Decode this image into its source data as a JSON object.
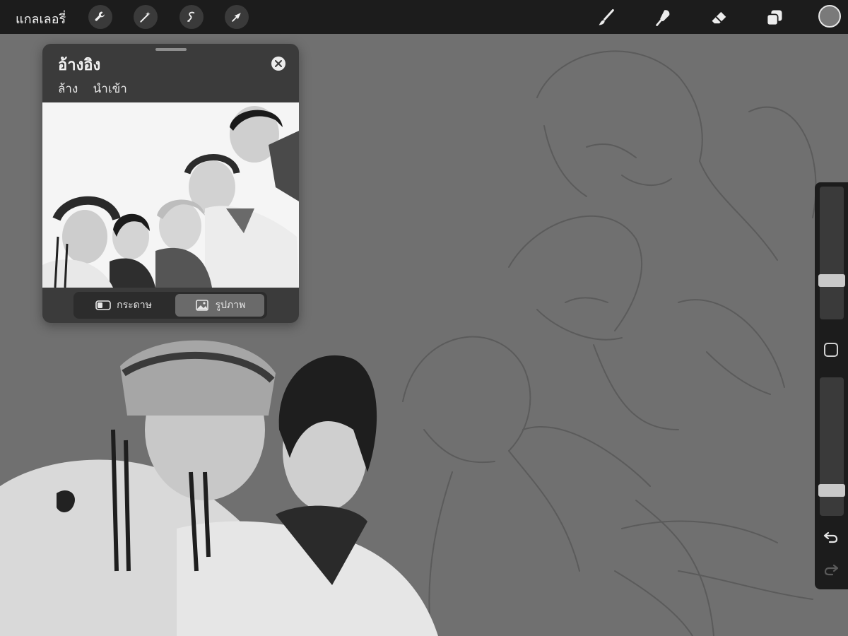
{
  "toolbar": {
    "gallery_label": "แกลเลอรี่",
    "left_tools": [
      "wrench-icon",
      "magic-wand-icon",
      "selection-icon",
      "move-arrow-icon"
    ],
    "right_tools": [
      "brush-icon",
      "smudge-icon",
      "eraser-icon",
      "layers-icon"
    ],
    "current_color": "#7a7a7a"
  },
  "reference": {
    "title": "อ้างอิง",
    "actions": [
      "ล้าง",
      "นำเข้า"
    ],
    "modes": [
      {
        "label": "กระดาษ",
        "icon": "canvas-icon",
        "active": false
      },
      {
        "label": "รูปภาพ",
        "icon": "image-icon",
        "active": true
      }
    ]
  },
  "sidebar": {
    "brush_size": 0.27,
    "opacity": 0.15,
    "undo_icon": "undo-icon",
    "redo_icon": "redo-icon"
  },
  "colors": {
    "toolbar_bg": "#1c1c1c",
    "canvas_bg": "#707070",
    "panel_bg": "#3b3b3b"
  }
}
